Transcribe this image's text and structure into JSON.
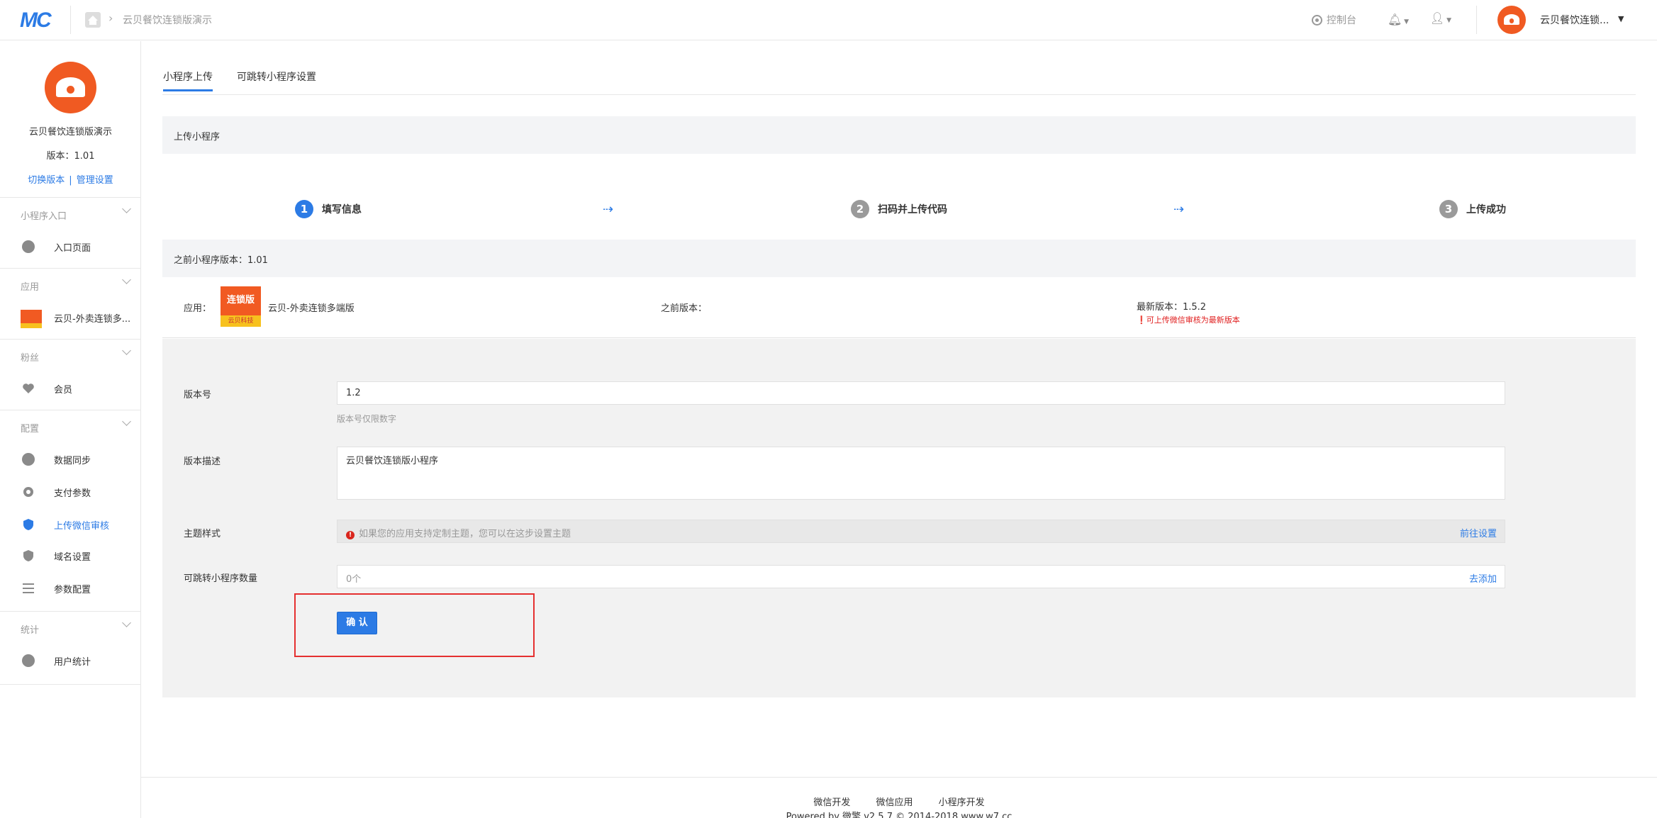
{
  "topbar": {
    "logo": "MC",
    "breadcrumb": "云贝餐饮连锁版演示",
    "console": "控制台",
    "account_name": "云贝餐饮连锁..."
  },
  "sidebar": {
    "account_name": "云贝餐饮连锁版演示",
    "version": "版本：1.01",
    "switch_version": "切换版本",
    "separator": "|",
    "manage_settings": "管理设置",
    "sections": [
      {
        "title": "小程序入口",
        "items": [
          {
            "label": "入口页面",
            "icon": "link-icon"
          }
        ]
      },
      {
        "title": "应用",
        "items": [
          {
            "label": "云贝-外卖连锁多...",
            "icon": "app-thumbnail"
          }
        ]
      },
      {
        "title": "粉丝",
        "items": [
          {
            "label": "会员",
            "icon": "heart-icon"
          }
        ]
      },
      {
        "title": "配置",
        "items": [
          {
            "label": "数据同步",
            "icon": "link-icon"
          },
          {
            "label": "支付参数",
            "icon": "gear-icon"
          },
          {
            "label": "上传微信审核",
            "icon": "shield-icon",
            "active": true
          },
          {
            "label": "域名设置",
            "icon": "shield-icon"
          },
          {
            "label": "参数配置",
            "icon": "list-icon"
          }
        ]
      },
      {
        "title": "统计",
        "items": [
          {
            "label": "用户统计",
            "icon": "refresh-icon"
          }
        ]
      }
    ]
  },
  "tabs": [
    {
      "label": "小程序上传",
      "active": true
    },
    {
      "label": "可跳转小程序设置",
      "active": false
    }
  ],
  "upload_panel": {
    "title": "上传小程序",
    "steps": [
      {
        "num": "1",
        "label": "填写信息",
        "active": true
      },
      {
        "num": "2",
        "label": "扫码并上传代码",
        "active": false
      },
      {
        "num": "3",
        "label": "上传成功",
        "active": false
      }
    ],
    "arrow": "⇢"
  },
  "prev_panel": {
    "title": "之前小程序版本：1.01",
    "app_label": "应用：",
    "app_logo_top": "连锁版",
    "app_logo_bottom": "云贝科技",
    "app_name": "云贝-外卖连锁多端版",
    "prev_version_label": "之前版本：",
    "latest_version": "最新版本：1.5.2",
    "warning": "❗可上传微信审核为最新版本"
  },
  "form": {
    "version_label": "版本号",
    "version_value": "1.2",
    "version_help": "版本号仅限数字",
    "desc_label": "版本描述",
    "desc_value": "云贝餐饮连锁版小程序",
    "theme_label": "主题样式",
    "theme_notice": "如果您的应用支持定制主题，您可以在这步设置主题",
    "theme_link": "前往设置",
    "jump_label": "可跳转小程序数量",
    "jump_value": "0个",
    "jump_link": "去添加",
    "confirm": "确 认"
  },
  "footer": {
    "links": [
      "微信开发",
      "微信应用",
      "小程序开发"
    ],
    "powered": "Powered by 微擎 v2.5.7 © 2014-2018 www.w7.cc"
  },
  "colors": {
    "accent": "#2c7be5",
    "brand_orange": "#f05a22",
    "warning_red": "#e02020",
    "highlight_box": "#e53030"
  }
}
